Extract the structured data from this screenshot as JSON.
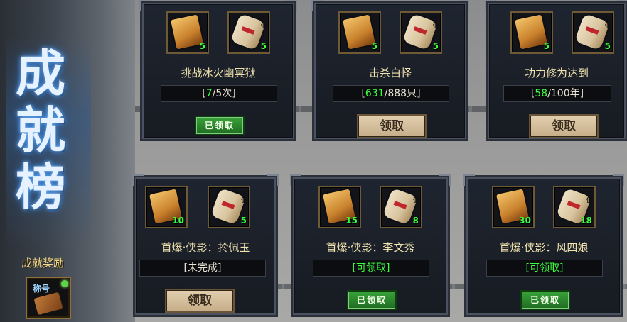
{
  "sidebar": {
    "title_chars": [
      "成",
      "就",
      "榜"
    ],
    "reward_label": "成就奖励",
    "title_slot_tag": "称号"
  },
  "cards": [
    {
      "title": "挑战冰火幽冥狱",
      "progress_prefix": "[",
      "progress_current": "7",
      "progress_suffix": "/5次]",
      "reward1_qty": "5",
      "reward2_qty": "5",
      "reward2_note": "文值",
      "button": "已领取",
      "state": "claimed"
    },
    {
      "title": "击杀白怪",
      "progress_prefix": "[",
      "progress_current": "631",
      "progress_suffix": "/888只]",
      "reward1_qty": "5",
      "reward2_qty": "5",
      "reward2_note": "文值",
      "button": "领取",
      "state": "claim"
    },
    {
      "title": "功力修为达到",
      "progress_prefix": "[",
      "progress_current": "58",
      "progress_suffix": "/100年]",
      "reward1_qty": "5",
      "reward2_qty": "5",
      "reward2_note": "文值",
      "button": "领取",
      "state": "claim"
    },
    {
      "title": "首爆·侠影：扵佩玉",
      "progress_text": "[未完成]",
      "reward1_qty": "10",
      "reward2_qty": "5",
      "reward2_note": "文值",
      "button": "领取",
      "state": "claim"
    },
    {
      "title": "首爆·侠影：李文秀",
      "progress_text": "[可领取]",
      "reward1_qty": "15",
      "reward2_qty": "8",
      "reward2_note": "文值",
      "button": "已领取",
      "state": "claimed"
    },
    {
      "title": "首爆·侠影：风四娘",
      "progress_text": "[可领取]",
      "reward1_qty": "30",
      "reward2_qty": "18",
      "reward2_note": "文值",
      "button": "已领取",
      "state": "claimed"
    }
  ],
  "colors": {
    "progress_green": "#3cff3c",
    "title_gold": "#f0e3b0",
    "claimed_green": "#2f8f31"
  }
}
